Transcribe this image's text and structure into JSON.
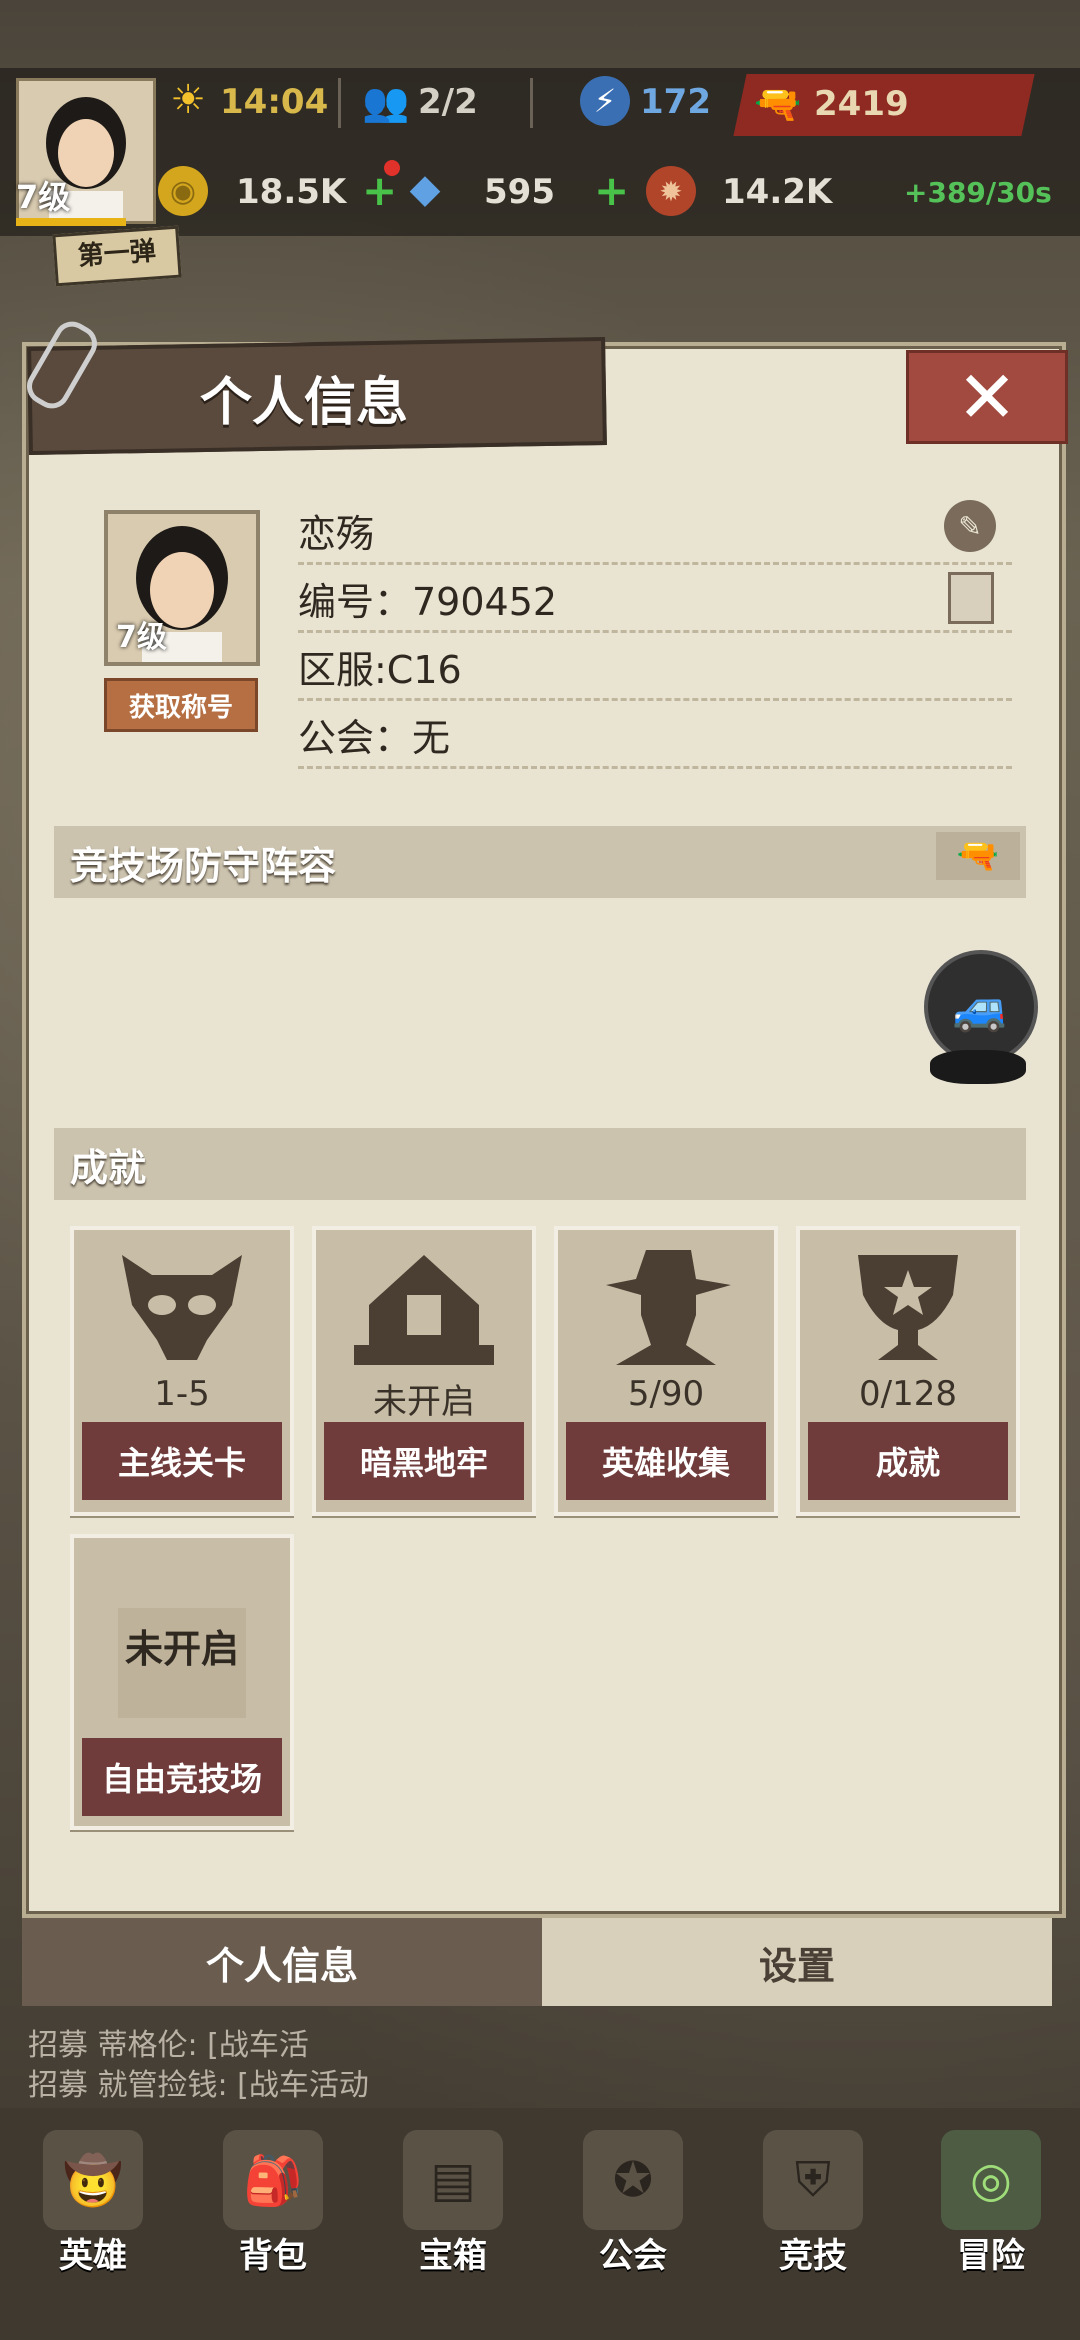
{
  "status_bar": {
    "level": "7级",
    "time": "14:04",
    "party": "2/2",
    "energy": "172",
    "power": "2419",
    "gold": "18.5K",
    "gems": "595",
    "caps": "14.2K",
    "rate": "+389/30s"
  },
  "event_tag": "第一弹",
  "dialog": {
    "title": "个人信息",
    "profile": {
      "level": "7级",
      "title_button": "获取称号",
      "name": "恋殇",
      "id_line": "编号：790452",
      "server_line": "区服:C16",
      "guild_line": "公会：无"
    },
    "arena_section": "竞技场防守阵容",
    "achievement_section": "成就",
    "achievements": [
      {
        "value": "1-5",
        "label": "主线关卡"
      },
      {
        "value": "未开启",
        "label": "暗黑地牢"
      },
      {
        "value": "5/90",
        "label": "英雄收集"
      },
      {
        "value": "0/128",
        "label": "成就"
      },
      {
        "value": "未开启",
        "label": "自由竞技场"
      }
    ]
  },
  "tabs": {
    "active": "个人信息",
    "inactive": "设置"
  },
  "ticker": [
    "招募    蒂格伦: [战车活",
    "招募    就管捡钱: [战车活动"
  ],
  "nav": [
    {
      "label": "英雄"
    },
    {
      "label": "背包"
    },
    {
      "label": "宝箱"
    },
    {
      "label": "公会"
    },
    {
      "label": "竞技"
    },
    {
      "label": "冒险"
    }
  ]
}
